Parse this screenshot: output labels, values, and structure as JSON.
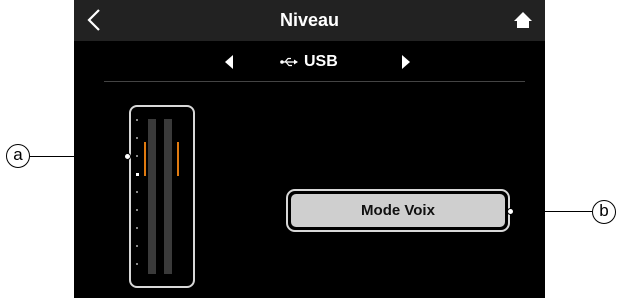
{
  "header": {
    "title": "Niveau",
    "back_icon": "chevron-left-icon",
    "home_icon": "home-icon"
  },
  "source": {
    "label": "USB",
    "icon": "usb-icon"
  },
  "meter": {
    "channel_count": 2,
    "peak_color": "#e07a10"
  },
  "mode_button": {
    "label": "Mode Voix"
  },
  "callouts": {
    "a": "a",
    "b": "b"
  },
  "colors": {
    "screen_bg": "#000000",
    "titlebar_bg": "#222222",
    "button_bg": "#cfcfcf"
  }
}
